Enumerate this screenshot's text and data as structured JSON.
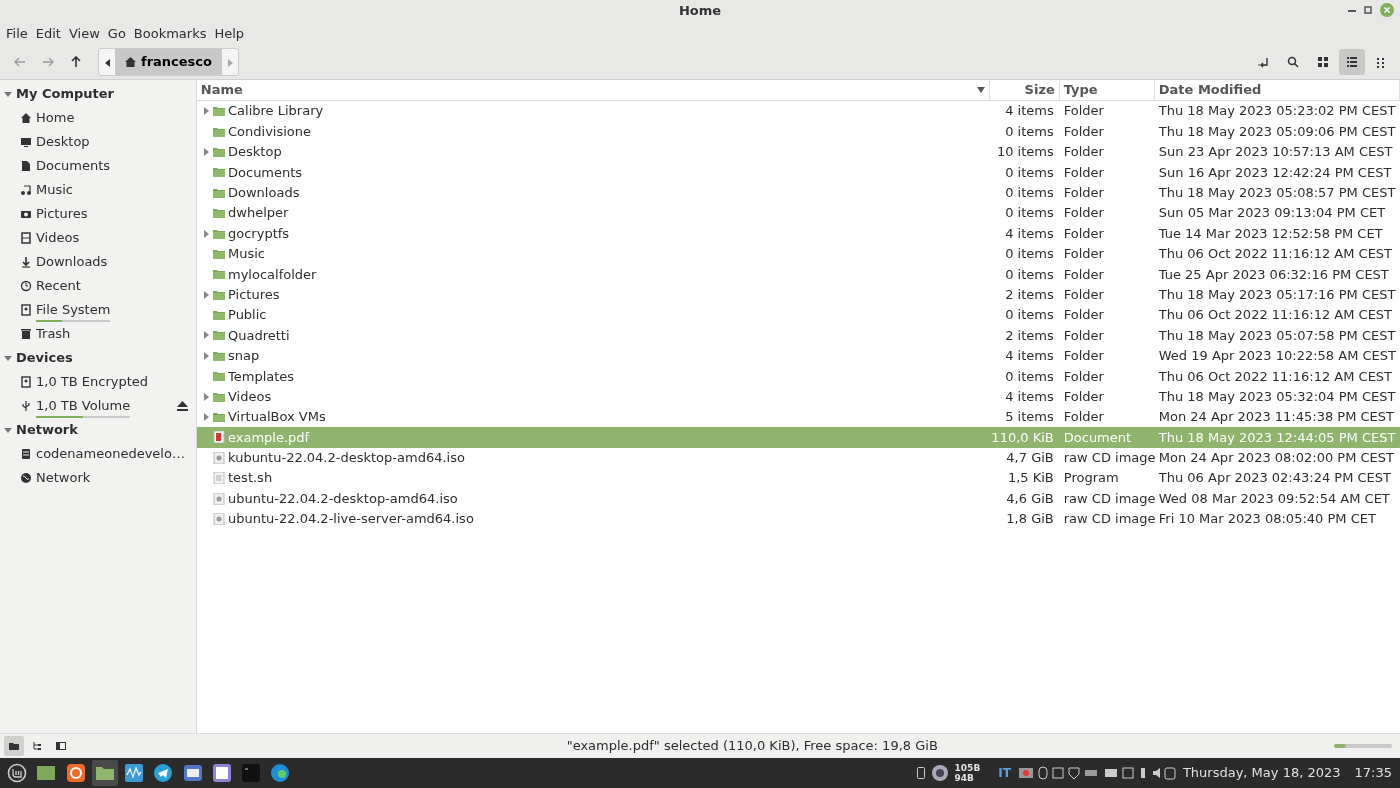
{
  "window": {
    "title": "Home"
  },
  "menu": [
    "File",
    "Edit",
    "View",
    "Go",
    "Bookmarks",
    "Help"
  ],
  "path": {
    "crumb": "francesco"
  },
  "view_buttons": [
    {
      "kind": "toggle-path",
      "selected": false
    },
    {
      "kind": "search",
      "selected": false
    },
    {
      "kind": "icons",
      "selected": false
    },
    {
      "kind": "list",
      "selected": true
    },
    {
      "kind": "compact",
      "selected": false
    }
  ],
  "sidebar": [
    {
      "title": "My Computer",
      "expanded": true,
      "items": [
        {
          "label": "Home",
          "kind": "home",
          "selected": false
        },
        {
          "label": "Desktop",
          "kind": "desktop",
          "selected": false
        },
        {
          "label": "Documents",
          "kind": "doc",
          "selected": false
        },
        {
          "label": "Music",
          "kind": "music",
          "selected": false
        },
        {
          "label": "Pictures",
          "kind": "camera",
          "selected": false
        },
        {
          "label": "Videos",
          "kind": "film",
          "selected": false
        },
        {
          "label": "Downloads",
          "kind": "down",
          "selected": false
        },
        {
          "label": "Recent",
          "kind": "clock",
          "selected": false
        },
        {
          "label": "File System",
          "kind": "drive",
          "selected": false,
          "level": 0.35
        },
        {
          "label": "Trash",
          "kind": "trash",
          "selected": false
        }
      ]
    },
    {
      "title": "Devices",
      "expanded": true,
      "items": [
        {
          "label": "1,0 TB Encrypted",
          "kind": "drive",
          "selected": false
        },
        {
          "label": "1,0 TB Volume",
          "kind": "usb",
          "selected": false,
          "level": 0.5,
          "eject": true
        }
      ]
    },
    {
      "title": "Network",
      "expanded": true,
      "items": [
        {
          "label": "codenameonedevelo…",
          "kind": "server",
          "selected": false
        },
        {
          "label": "Network",
          "kind": "globe",
          "selected": false
        }
      ]
    }
  ],
  "table": {
    "columns": [
      "Name",
      "Size",
      "Type",
      "Date Modified"
    ],
    "rows": [
      {
        "name": "Calibre Library",
        "kind": "folder",
        "expandable": true,
        "size": "4 items",
        "type": "Folder",
        "date": "Thu 18 May 2023 05:23:02 PM CEST",
        "selected": false
      },
      {
        "name": "Condivisione",
        "kind": "folder",
        "expandable": false,
        "size": "0 items",
        "type": "Folder",
        "date": "Thu 18 May 2023 05:09:06 PM CEST",
        "selected": false
      },
      {
        "name": "Desktop",
        "kind": "folder",
        "expandable": true,
        "size": "10 items",
        "type": "Folder",
        "date": "Sun 23 Apr 2023 10:57:13 AM CEST",
        "selected": false
      },
      {
        "name": "Documents",
        "kind": "folder",
        "expandable": false,
        "size": "0 items",
        "type": "Folder",
        "date": "Sun 16 Apr 2023 12:42:24 PM CEST",
        "selected": false
      },
      {
        "name": "Downloads",
        "kind": "folder",
        "expandable": false,
        "size": "0 items",
        "type": "Folder",
        "date": "Thu 18 May 2023 05:08:57 PM CEST",
        "selected": false
      },
      {
        "name": "dwhelper",
        "kind": "folder",
        "expandable": false,
        "size": "0 items",
        "type": "Folder",
        "date": "Sun 05 Mar 2023 09:13:04 PM CET",
        "selected": false
      },
      {
        "name": "gocryptfs",
        "kind": "folder",
        "expandable": true,
        "size": "4 items",
        "type": "Folder",
        "date": "Tue 14 Mar 2023 12:52:58 PM CET",
        "selected": false
      },
      {
        "name": "Music",
        "kind": "folder",
        "expandable": false,
        "size": "0 items",
        "type": "Folder",
        "date": "Thu 06 Oct 2022 11:16:12 AM CEST",
        "selected": false
      },
      {
        "name": "mylocalfolder",
        "kind": "folder",
        "expandable": false,
        "size": "0 items",
        "type": "Folder",
        "date": "Tue 25 Apr 2023 06:32:16 PM CEST",
        "selected": false
      },
      {
        "name": "Pictures",
        "kind": "folder",
        "expandable": true,
        "size": "2 items",
        "type": "Folder",
        "date": "Thu 18 May 2023 05:17:16 PM CEST",
        "selected": false
      },
      {
        "name": "Public",
        "kind": "folder",
        "expandable": false,
        "size": "0 items",
        "type": "Folder",
        "date": "Thu 06 Oct 2022 11:16:12 AM CEST",
        "selected": false
      },
      {
        "name": "Quadretti",
        "kind": "folder",
        "expandable": true,
        "size": "2 items",
        "type": "Folder",
        "date": "Thu 18 May 2023 05:07:58 PM CEST",
        "selected": false
      },
      {
        "name": "snap",
        "kind": "folder",
        "expandable": true,
        "size": "4 items",
        "type": "Folder",
        "date": "Wed 19 Apr 2023 10:22:58 AM CEST",
        "selected": false
      },
      {
        "name": "Templates",
        "kind": "folder",
        "expandable": false,
        "size": "0 items",
        "type": "Folder",
        "date": "Thu 06 Oct 2022 11:16:12 AM CEST",
        "selected": false
      },
      {
        "name": "Videos",
        "kind": "folder",
        "expandable": true,
        "size": "4 items",
        "type": "Folder",
        "date": "Thu 18 May 2023 05:32:04 PM CEST",
        "selected": false
      },
      {
        "name": "VirtualBox VMs",
        "kind": "folder",
        "expandable": true,
        "size": "5 items",
        "type": "Folder",
        "date": "Mon 24 Apr 2023 11:45:38 PM CEST",
        "selected": false
      },
      {
        "name": "example.pdf",
        "kind": "pdf",
        "expandable": false,
        "size": "110,0 KiB",
        "type": "Document",
        "date": "Thu 18 May 2023 12:44:05 PM CEST",
        "selected": true
      },
      {
        "name": "kubuntu-22.04.2-desktop-amd64.iso",
        "kind": "iso",
        "expandable": false,
        "size": "4,7 GiB",
        "type": "raw CD image",
        "date": "Mon 24 Apr 2023 08:02:00 PM CEST",
        "selected": false
      },
      {
        "name": "test.sh",
        "kind": "script",
        "expandable": false,
        "size": "1,5 KiB",
        "type": "Program",
        "date": "Thu 06 Apr 2023 02:43:24 PM CEST",
        "selected": false
      },
      {
        "name": "ubuntu-22.04.2-desktop-amd64.iso",
        "kind": "iso",
        "expandable": false,
        "size": "4,6 GiB",
        "type": "raw CD image",
        "date": "Wed 08 Mar 2023 09:52:54 AM CET",
        "selected": false
      },
      {
        "name": "ubuntu-22.04.2-live-server-amd64.iso",
        "kind": "iso",
        "expandable": false,
        "size": "1,8 GiB",
        "type": "raw CD image",
        "date": "Fri 10 Mar 2023 08:05:40 PM CET",
        "selected": false
      }
    ]
  },
  "status_bar": {
    "text": "\"example.pdf\" selected (110,0 KiB), Free space: 19,8 GiB",
    "zoom": {
      "level": 0.2
    },
    "pane_buttons": [
      {
        "kind": "places",
        "selected": true
      },
      {
        "kind": "tree",
        "selected": false
      },
      {
        "kind": "sidebar",
        "selected": false
      }
    ]
  },
  "taskbar": {
    "apps": [
      {
        "kind": "menu",
        "active": false
      },
      {
        "kind": "desktop",
        "active": false
      },
      {
        "kind": "firefox",
        "active": false
      },
      {
        "kind": "files",
        "active": true
      },
      {
        "kind": "monitor",
        "active": false
      },
      {
        "kind": "telegram",
        "active": false
      },
      {
        "kind": "mail",
        "active": false
      },
      {
        "kind": "notes",
        "active": false
      },
      {
        "kind": "terminal",
        "active": false
      },
      {
        "kind": "edge",
        "active": false
      }
    ],
    "net_down": "105B",
    "net_up": "94B",
    "keyboard": "IT",
    "date": "Thursday, May 18, 2023",
    "time": "17:35"
  }
}
